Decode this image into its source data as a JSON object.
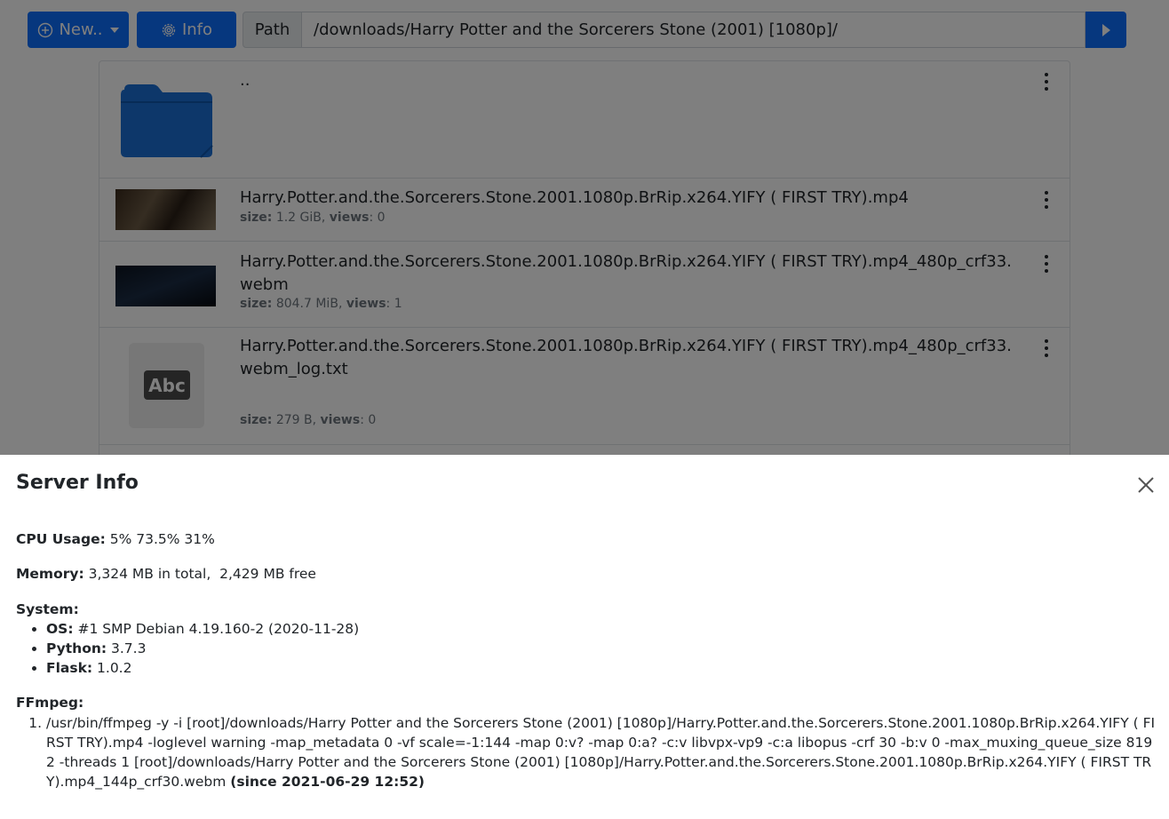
{
  "toolbar": {
    "new_label": "New..",
    "info_label": "Info",
    "path_label": "Path",
    "path_value": "/downloads/Harry Potter and the Sorcerers Stone (2001) [1080p]/"
  },
  "files": [
    {
      "name": ".."
    },
    {
      "name": "Harry.Potter.and.the.Sorcerers.Stone.2001.1080p.BrRip.x264.YIFY ( FIRST TRY).mp4",
      "size_label": "size:",
      "size": "1.2 GiB",
      "views_label": "views",
      "views": "0"
    },
    {
      "name": "Harry.Potter.and.the.Sorcerers.Stone.2001.1080p.BrRip.x264.YIFY ( FIRST TRY).mp4_480p_crf33.webm",
      "size_label": "size:",
      "size": "804.7 MiB",
      "views_label": "views",
      "views": "1"
    },
    {
      "name": "Harry.Potter.and.the.Sorcerers.Stone.2001.1080p.BrRip.x264.YIFY ( FIRST TRY).mp4_480p_crf33.webm_log.txt",
      "size_label": "size:",
      "size": "279 B",
      "views_label": "views",
      "views": "0",
      "icon_text": "Abc"
    }
  ],
  "modal": {
    "title": "Server Info",
    "cpu_label": "CPU Usage:",
    "cpu_value": "5% 73.5% 31%",
    "memory_label": "Memory:",
    "memory_value": "3,324 MB in total,  2,429 MB free",
    "system_label": "System:",
    "system_items": [
      {
        "label": "OS:",
        "value": "#1 SMP Debian 4.19.160-2 (2020-11-28)"
      },
      {
        "label": "Python:",
        "value": "3.7.3"
      },
      {
        "label": "Flask:",
        "value": "1.0.2"
      }
    ],
    "ffmpeg_label": "FFmpeg:",
    "ffmpeg_jobs": [
      {
        "command": "/usr/bin/ffmpeg -y -i [root]/downloads/Harry Potter and the Sorcerers Stone (2001) [1080p]/Harry.Potter.and.the.Sorcerers.Stone.2001.1080p.BrRip.x264.YIFY ( FIRST TRY).mp4 -loglevel warning -map_metadata 0 -vf scale=-1:144 -map 0:v? -map 0:a? -c:v libvpx-vp9 -c:a libopus -crf 30 -b:v 0 -max_muxing_queue_size 8192 -threads 1 [root]/downloads/Harry Potter and the Sorcerers Stone (2001) [1080p]/Harry.Potter.and.the.Sorcerers.Stone.2001.1080p.BrRip.x264.YIFY ( FIRST TRY).mp4_144p_crf30.webm",
        "since": "(since 2021-06-29 12:52)"
      }
    ]
  },
  "colors": {
    "primary": "#0d6efd",
    "folder": "#1a6fd4",
    "backdrop": "rgba(0,0,0,0.5)"
  },
  "icons": [
    "plus-circle-icon",
    "gear-icon",
    "play-icon",
    "folder-icon",
    "kebab-icon",
    "text-file-icon",
    "close-icon"
  ]
}
